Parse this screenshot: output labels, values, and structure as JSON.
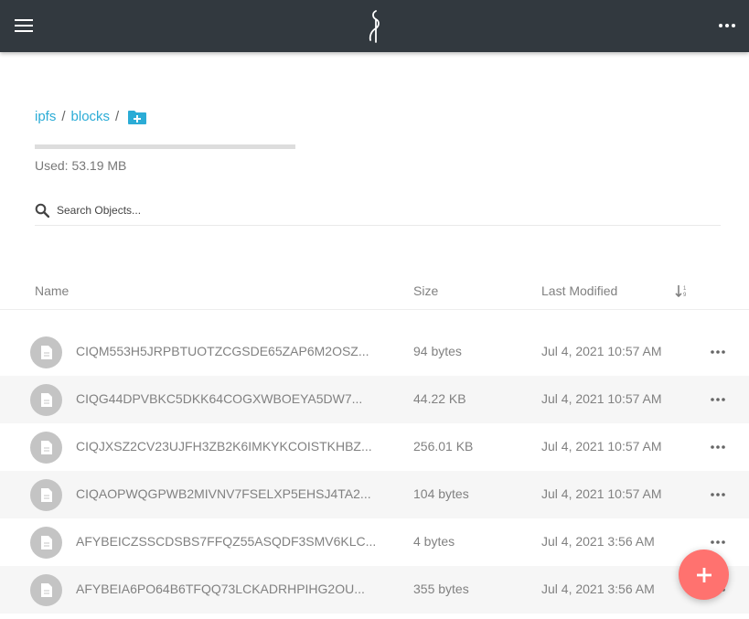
{
  "header": {
    "menu_icon": "hamburger-icon",
    "logo_icon": "minio-logo",
    "more_icon": "more-horizontal-icon"
  },
  "breadcrumb": {
    "items": [
      {
        "label": "ipfs"
      },
      {
        "label": "blocks"
      }
    ],
    "separator": "/",
    "new_folder_icon": "folder-plus-icon"
  },
  "storage": {
    "used_text": "Used: 53.19 MB"
  },
  "search": {
    "placeholder": "Search Objects..."
  },
  "table": {
    "columns": {
      "name": "Name",
      "size": "Size",
      "modified": "Last Modified"
    },
    "sort_icon": "sort-descending-icon",
    "rows": [
      {
        "name": "CIQM553H5JRPBTUOTZCGSDE65ZAP6M2OSZ...",
        "size": "94 bytes",
        "modified": "Jul 4, 2021 10:57 AM"
      },
      {
        "name": "CIQG44DPVBKC5DKK64COGXWBOEYA5DW7...",
        "size": "44.22 KB",
        "modified": "Jul 4, 2021 10:57 AM"
      },
      {
        "name": "CIQJXSZ2CV23UJFH3ZB2K6IMKYKCOISTKHBZ...",
        "size": "256.01 KB",
        "modified": "Jul 4, 2021 10:57 AM"
      },
      {
        "name": "CIQAOPWQGPWB2MIVNV7FSELXP5EHSJ4TA2...",
        "size": "104 bytes",
        "modified": "Jul 4, 2021 10:57 AM"
      },
      {
        "name": "AFYBEICZSSCDSBS7FFQZ55ASQDF3SMV6KLC...",
        "size": "4 bytes",
        "modified": "Jul 4, 2021 3:56 AM"
      },
      {
        "name": "AFYBEIA6PO64B6TFQQ73LCKADRHPIHG2OU...",
        "size": "355 bytes",
        "modified": "Jul 4, 2021 3:56 AM"
      }
    ]
  },
  "fab": {
    "icon": "plus-icon",
    "color": "#ff726f"
  },
  "colors": {
    "topbar": "#32393f",
    "link": "#2bacd6",
    "file_icon_bg": "#c4c4c4"
  }
}
